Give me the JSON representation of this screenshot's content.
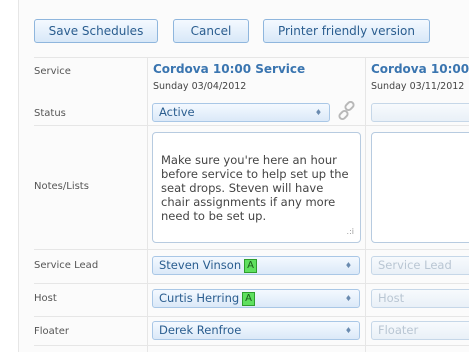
{
  "toolbar": {
    "save_label": "Save Schedules",
    "cancel_label": "Cancel",
    "printer_label": "Printer friendly version"
  },
  "labels": {
    "service": "Service",
    "status": "Status",
    "notes": "Notes/Lists",
    "service_lead": "Service Lead",
    "host": "Host",
    "floater": "Floater"
  },
  "columns": [
    {
      "title": "Cordova 10:00 Service",
      "date": "Sunday 03/04/2012",
      "status": "Active",
      "notes": "Make sure you're here an hour before service to help set up the seat drops. Steven will have chair assignments if any more need to be set up.",
      "service_lead": "Steven Vinson",
      "service_lead_badge": "A",
      "host": "Curtis Herring",
      "host_badge": "A",
      "floater": "Derek Renfroe"
    },
    {
      "title": "Cordova 10:00",
      "date": "Sunday 03/11/2012",
      "status": "",
      "notes": "",
      "service_lead": "Service Lead",
      "host": "Host",
      "floater": "Floater"
    }
  ]
}
